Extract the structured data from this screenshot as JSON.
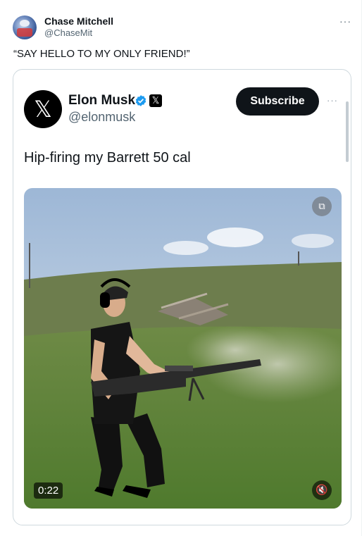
{
  "tweet": {
    "author_name": "Chase Mitchell",
    "author_handle": "@ChaseMit",
    "more_icon": "more-icon",
    "text": "“SAY HELLO TO MY ONLY FRIEND!”"
  },
  "embedded_tweet": {
    "author_name": "Elon Musk",
    "author_handle": "@elonmusk",
    "verified_icon": "verified-badge-icon",
    "x_badge_icon": "x-logo-icon",
    "subscribe_label": "Subscribe",
    "text": "Hip-firing my Barrett 50 cal",
    "video": {
      "duration": "0:22",
      "gif_icon": "gif-icon",
      "mute_icon": "mute-icon"
    }
  },
  "colors": {
    "text_primary": "#0f1419",
    "text_secondary": "#536471",
    "border": "#cfd9de",
    "verified_blue": "#1d9bf0",
    "subscribe_bg": "#0f1419"
  }
}
